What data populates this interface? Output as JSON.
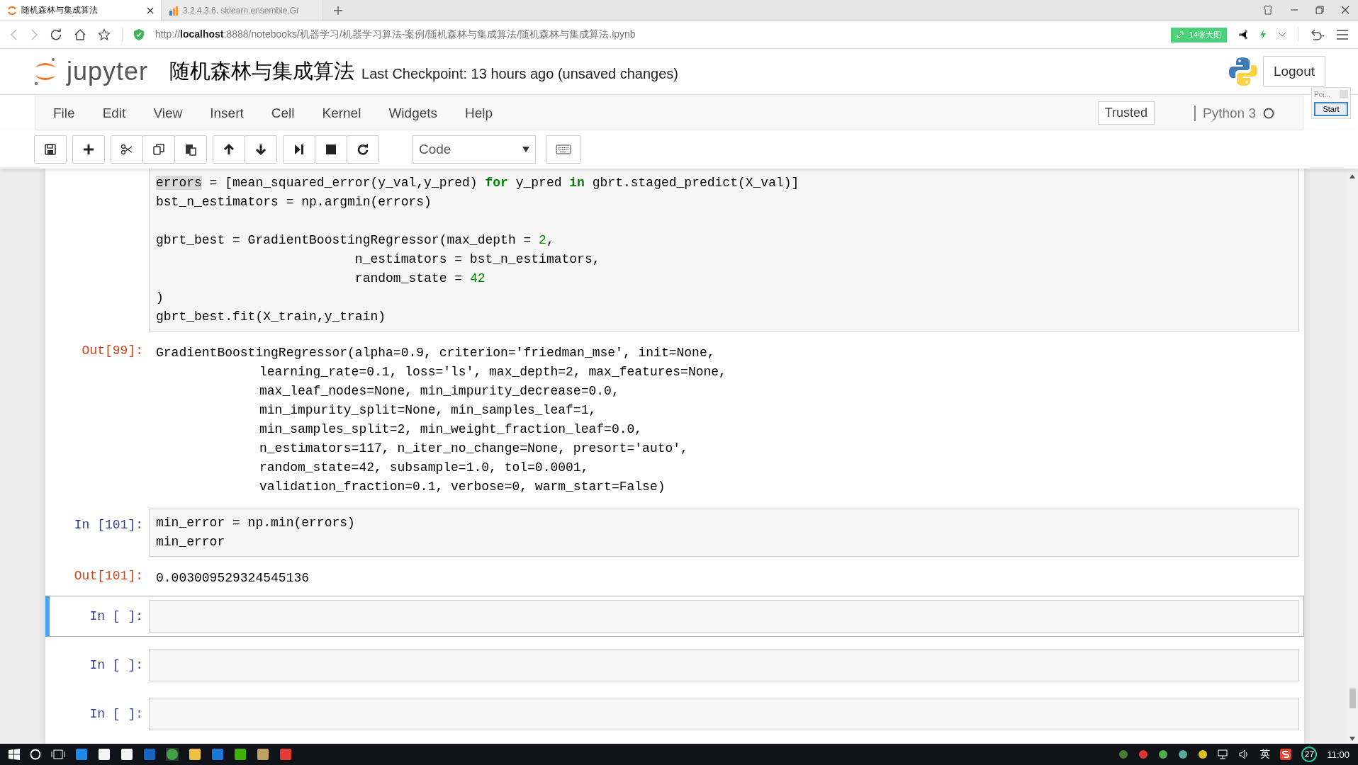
{
  "browser": {
    "tabs": [
      {
        "title": "随机森林与集成算法",
        "selected": true
      },
      {
        "title": "3.2.4.3.6. sklearn.ensemble.Gr",
        "selected": false
      }
    ],
    "url": "http://**localhost**:8888/notebooks/机器学习/机器学习算法-案例/随机森林与集成算法/随机森林与集成算法.ipynb",
    "badge": "14张大图"
  },
  "header": {
    "logo": "jupyter",
    "notebook_name": "随机森林与集成算法",
    "checkpoint": "Last Checkpoint: 13 hours ago (unsaved changes)",
    "logout": "Logout"
  },
  "menubar": {
    "items": [
      "File",
      "Edit",
      "View",
      "Insert",
      "Cell",
      "Kernel",
      "Widgets",
      "Help"
    ],
    "trusted": "Trusted",
    "kernel": "Python 3"
  },
  "popup": {
    "title": "Poi...",
    "button": "Start"
  },
  "toolbar": {
    "cell_type": "Code"
  },
  "cells": [
    {
      "kind": "code",
      "selected": false,
      "lines": [
        {
          "kind": "code",
          "segments": [
            {
              "kind": "hl",
              "text": "errors"
            },
            {
              "kind": "plain",
              "text": " = [mean_squared_error(y_val,y_pred) "
            },
            {
              "kind": "kw",
              "text": "for"
            },
            {
              "kind": "plain",
              "text": " y_pred "
            },
            {
              "kind": "kw",
              "text": "in"
            },
            {
              "kind": "plain",
              "text": " gbrt.staged_predict(X_val)]"
            }
          ]
        },
        {
          "kind": "code",
          "segments": [
            {
              "kind": "plain",
              "text": "bst_n_estimators = np.argmin(errors)"
            }
          ]
        },
        {
          "kind": "blank"
        },
        {
          "kind": "code",
          "segments": [
            {
              "kind": "plain",
              "text": "gbrt_best = GradientBoostingRegressor(max_depth = "
            },
            {
              "kind": "num",
              "text": "2"
            },
            {
              "kind": "plain",
              "text": ","
            }
          ]
        },
        {
          "kind": "code",
          "segments": [
            {
              "kind": "plain",
              "text": "                          n_estimators = bst_n_estimators,"
            }
          ]
        },
        {
          "kind": "code",
          "segments": [
            {
              "kind": "plain",
              "text": "                          random_state = "
            },
            {
              "kind": "num",
              "text": "42"
            }
          ]
        },
        {
          "kind": "code",
          "segments": [
            {
              "kind": "plain",
              "text": ")"
            }
          ]
        },
        {
          "kind": "code",
          "segments": [
            {
              "kind": "plain",
              "text": "gbrt_best.fit(X_train,y_train)"
            }
          ]
        }
      ]
    },
    {
      "kind": "output",
      "prompt": "Out[99]:",
      "lines": [
        "GradientBoostingRegressor(alpha=0.9, criterion='friedman_mse', init=None,",
        "learning_rate=0.1, loss='ls', max_depth=2, max_features=None,",
        "max_leaf_nodes=None, min_impurity_decrease=0.0,",
        "min_impurity_split=None, min_samples_leaf=1,",
        "min_samples_split=2, min_weight_fraction_leaf=0.0,",
        "n_estimators=117, n_iter_no_change=None, presort='auto',",
        "random_state=42, subsample=1.0, tol=0.0001,",
        "validation_fraction=0.1, verbose=0, warm_start=False)"
      ]
    },
    {
      "kind": "code",
      "prompt": "In [101]:",
      "selected": false,
      "lines": [
        {
          "kind": "code",
          "segments": [
            {
              "kind": "plain",
              "text": "min_error = np.min(errors)"
            }
          ]
        },
        {
          "kind": "code",
          "segments": [
            {
              "kind": "plain",
              "text": "min_error"
            }
          ]
        }
      ]
    },
    {
      "kind": "output",
      "prompt": "Out[101]:",
      "lines": [
        "0.003009529324545136"
      ]
    },
    {
      "kind": "code",
      "prompt": "In [ ]:",
      "selected": true
    },
    {
      "kind": "code",
      "prompt": "In [ ]:",
      "selected": false
    },
    {
      "kind": "code",
      "prompt": "In [ ]:",
      "selected": false
    }
  ],
  "taskbar": {
    "ime": "英",
    "badge": "27",
    "clock": "11:00"
  }
}
